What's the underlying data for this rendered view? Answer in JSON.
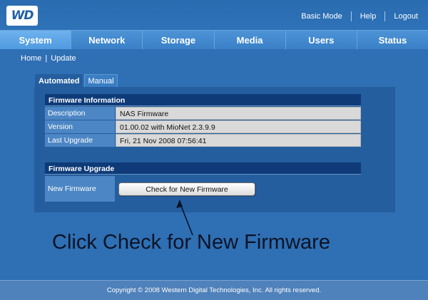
{
  "header": {
    "logo_text": "WD",
    "links": [
      "Basic Mode",
      "Help",
      "Logout"
    ]
  },
  "nav": {
    "tabs": [
      "System",
      "Network",
      "Storage",
      "Media",
      "Users",
      "Status"
    ],
    "active": "System"
  },
  "breadcrumb": {
    "home": "Home",
    "separator": "|",
    "current": "Update"
  },
  "subtabs": {
    "automated": "Automated",
    "manual": "Manual"
  },
  "firmware_info": {
    "title": "Firmware Information",
    "rows": [
      {
        "label": "Description",
        "value": "NAS Firmware"
      },
      {
        "label": "Version",
        "value": "01.00.02  with MioNet 2.3.9.9"
      },
      {
        "label": "Last Upgrade",
        "value": "Fri, 21 Nov 2008 07:56:41"
      }
    ]
  },
  "firmware_upgrade": {
    "title": "Firmware Upgrade",
    "label": "New Firmware",
    "button": "Check for New Firmware"
  },
  "annotation": "Click Check for New Firmware",
  "footer": "Copyright © 2008 Western Digital Technologies, Inc. All rights reserved.",
  "colors": {
    "background": "#2f6fb4",
    "panel": "#245e9f",
    "section_header": "#0e3b78",
    "label_cell": "#4d86c4",
    "value_cell": "#d9d9d9"
  }
}
